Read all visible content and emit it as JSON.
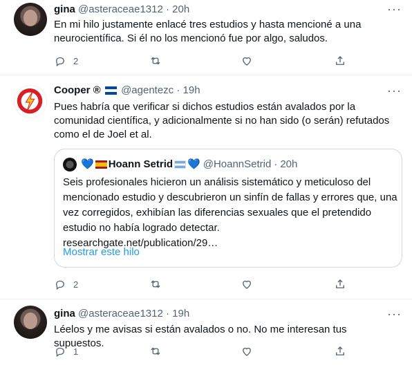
{
  "tweets": [
    {
      "name": "gina",
      "handle": "@asteraceae1312",
      "dot": "·",
      "time": "20h",
      "text": "En mi hilo justamente enlacé tres estudios y hasta mencioné a una neurocientífica. Si él no los mencionó fue por algo, saludos.",
      "reply_count": "2",
      "retweet_count": "",
      "like_count": ""
    },
    {
      "name": "Cooper ®",
      "handle": "@agentezc",
      "dot": "·",
      "time": "19h",
      "text": "Pues habría que verificar si dichos estudios están avalados por la comunidad científica, y adicionalmente si no han sido (o serán) refutados como el de Joel et al.",
      "reply_count": "2",
      "retweet_count": "",
      "like_count": "",
      "quote": {
        "name": "Hoann Setrid",
        "handle": "@HoannSetrid",
        "dot": "·",
        "time": "20h",
        "text": "Seis profesionales hicieron un análisis sistemático y meticuloso del mencionado estudio y descubrieron un sinfín de fallas y errores que, una vez corregidos, exhibían las diferencias sexuales que el pretendido estudio no había logrado detectar.",
        "link": "researchgate.net/publication/29…",
        "show_thread": "Mostrar este hilo"
      }
    },
    {
      "name": "gina",
      "handle": "@asteraceae1312",
      "dot": "·",
      "time": "19h",
      "text": "Léelos y me avisas si están avalados o no. No me interesan tus supuestos.",
      "reply_count": "1",
      "retweet_count": "",
      "like_count": ""
    }
  ],
  "colors": {
    "text": "#0f1419",
    "secondary": "#536471",
    "link": "#1d9bf0",
    "border": "#cfd9de",
    "divider": "#eff3f4"
  },
  "icons": {
    "reply": "reply-icon",
    "retweet": "retweet-icon",
    "like": "heart-icon",
    "share": "share-icon",
    "more": "more-icon",
    "verified_badge": "circle-r-icon"
  }
}
